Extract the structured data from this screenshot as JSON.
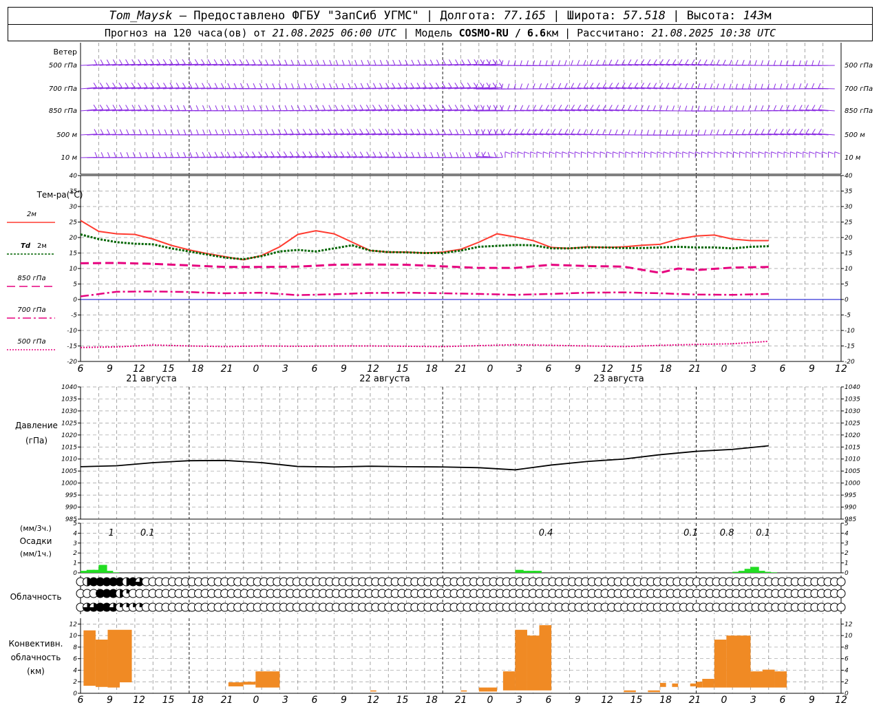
{
  "header": {
    "station": "Tom_Maysk",
    "provider": "– Предоставлено ФГБУ \"ЗапСиб УГМС\" |",
    "lon_label": "Долгота:",
    "lon": "77.165",
    "lat_label": "| Широта:",
    "lat": "57.518",
    "alt_label": "| Высота:",
    "alt": "143",
    "alt_unit": "м",
    "forecast_prefix": "Прогноз на 120 часа(ов) от",
    "issued": "21.08.2025 06:00 UTC",
    "model_label": "| Модель",
    "model": "COSMO-RU / 6.6",
    "model_unit": "км",
    "calc_label": "| Рассчитано:",
    "calculated": "21.08.2025 10:38 UTC"
  },
  "labels": {
    "wind_title": "Ветер",
    "wind_levels": [
      "500 гПа",
      "700 гПа",
      "850 гПа",
      "500 м",
      "10 м"
    ],
    "temp_title": "Тем-ра(°C)",
    "legend_2m": "2м",
    "legend_td": "Td",
    "legend_td_suffix": "2м",
    "legend_850": "850 гПа",
    "legend_700": "700 гПа",
    "legend_500": "500 гПа",
    "pressure_title": "Давление",
    "pressure_unit": "(гПа)",
    "precip_unit_3h": "(мм/3ч.)",
    "precip_title": "Осадки",
    "precip_unit_1h": "(мм/1ч.)",
    "cloud_title": "Облачность",
    "conv_title_1": "Конвективн.",
    "conv_title_2": "облачность",
    "conv_unit": "(км)"
  },
  "colors": {
    "wind": "#8a2be2",
    "t2m": "#ff3b30",
    "td2m": "#006400",
    "t850": "#e6007e",
    "t700": "#e6007e",
    "t500": "#e6007e",
    "zero_line": "#0000cc",
    "pressure": "#000000",
    "precip": "#22dd22",
    "convective": "#f08a24",
    "grid": "#999999"
  },
  "chart_data": [
    {
      "type": "line",
      "title": "Тем-ра(°C)",
      "x": [
        0,
        6,
        12,
        18,
        24,
        30,
        36,
        42,
        48,
        54,
        60,
        66,
        72,
        78,
        84,
        90,
        96,
        102,
        108,
        114,
        120,
        126
      ],
      "x_tick_labels": [
        "6",
        "9",
        "12",
        "15",
        "18",
        "21",
        "0",
        "3",
        "6",
        "9",
        "12",
        "15",
        "18",
        "21",
        "0",
        "3",
        "6",
        "9",
        "12",
        "15",
        "18",
        "21",
        "0",
        "3",
        "6",
        "9",
        "12"
      ],
      "day_labels": [
        "21 августа",
        "22 августа",
        "23 августа"
      ],
      "ylim": [
        -20,
        40
      ],
      "yticks": [
        -20,
        -15,
        -10,
        -5,
        0,
        5,
        10,
        15,
        20,
        25,
        30,
        35,
        40
      ],
      "series": [
        {
          "name": "2м",
          "style": "solid",
          "x": [
            0,
            3,
            6,
            9,
            12,
            15,
            18,
            21,
            24,
            27,
            30,
            33,
            36,
            39,
            42,
            45,
            48,
            51,
            54,
            57,
            60,
            63,
            66,
            69,
            72,
            75,
            78,
            81,
            84,
            87,
            90,
            93,
            96,
            99,
            102,
            105,
            108,
            111,
            114
          ],
          "values": [
            25.5,
            22,
            21.2,
            21,
            19.5,
            17.5,
            16,
            14.8,
            13.8,
            12.8,
            14.2,
            17,
            21,
            22.2,
            21.2,
            18.5,
            15.8,
            15.3,
            15.3,
            15,
            15.3,
            16.2,
            18.5,
            21.2,
            20.2,
            19,
            16.8,
            16.5,
            17,
            16.8,
            17,
            17.5,
            17.8,
            19.5,
            20.5,
            20.8,
            19.5,
            19,
            19
          ]
        },
        {
          "name": "Td 2м",
          "style": "dotted",
          "x": [
            0,
            3,
            6,
            9,
            12,
            15,
            18,
            21,
            24,
            27,
            30,
            33,
            36,
            39,
            42,
            45,
            48,
            51,
            54,
            57,
            60,
            63,
            66,
            69,
            72,
            75,
            78,
            81,
            84,
            87,
            90,
            93,
            96,
            99,
            102,
            105,
            108,
            111,
            114
          ],
          "values": [
            21,
            19.5,
            18.5,
            18,
            17.8,
            16.5,
            15.5,
            14.5,
            13.5,
            13,
            14,
            15.5,
            16,
            15.5,
            16.5,
            17.5,
            15.8,
            15.3,
            15.2,
            15,
            15,
            15.8,
            17,
            17.3,
            17.6,
            17.5,
            16.5,
            16.5,
            16.8,
            16.8,
            16.6,
            16.6,
            16.8,
            17,
            16.8,
            16.8,
            16.5,
            17,
            17.2
          ]
        },
        {
          "name": "850 гПа",
          "style": "dashed",
          "x": [
            0,
            6,
            12,
            18,
            24,
            30,
            36,
            42,
            48,
            54,
            60,
            66,
            72,
            78,
            84,
            90,
            96,
            99,
            102,
            108,
            114
          ],
          "values": [
            11.7,
            11.8,
            11.5,
            11,
            10.5,
            10.5,
            10.6,
            11.2,
            11.3,
            11.2,
            10.7,
            10.2,
            10.2,
            11.2,
            10.8,
            10.6,
            8.6,
            10,
            9.5,
            10.3,
            10.5
          ]
        },
        {
          "name": "700 гПа",
          "style": "dashdot",
          "x": [
            0,
            6,
            12,
            18,
            24,
            30,
            36,
            42,
            48,
            54,
            60,
            66,
            72,
            78,
            84,
            90,
            96,
            102,
            108,
            114
          ],
          "values": [
            1,
            2.5,
            2.6,
            2.4,
            2,
            2.2,
            1.4,
            1.7,
            2.1,
            2.2,
            2,
            1.8,
            1.5,
            1.8,
            2.2,
            2.3,
            2,
            1.6,
            1.5,
            1.8
          ]
        },
        {
          "name": "500 гПа",
          "style": "dotted",
          "x": [
            0,
            6,
            12,
            18,
            24,
            30,
            36,
            42,
            48,
            54,
            60,
            66,
            72,
            78,
            84,
            90,
            96,
            102,
            108,
            114
          ],
          "values": [
            -15.5,
            -15.3,
            -14.7,
            -15,
            -15.2,
            -15,
            -15.1,
            -15,
            -15,
            -15.1,
            -15.2,
            -14.9,
            -14.6,
            -14.8,
            -15,
            -15.2,
            -14.8,
            -14.5,
            -14.3,
            -13.5
          ]
        }
      ]
    },
    {
      "type": "line",
      "title": "Давление",
      "ylabel": "(гПа)",
      "ylim": [
        985,
        1040
      ],
      "yticks": [
        985,
        990,
        995,
        1000,
        1005,
        1010,
        1015,
        1020,
        1025,
        1030,
        1035,
        1040
      ],
      "x": [
        0,
        6,
        12,
        18,
        24,
        30,
        36,
        42,
        48,
        54,
        60,
        66,
        72,
        78,
        84,
        90,
        96,
        102,
        108,
        114
      ],
      "values": [
        1006.8,
        1007.2,
        1008.5,
        1009.3,
        1009.4,
        1008.5,
        1006.9,
        1006.7,
        1007.0,
        1006.8,
        1006.7,
        1006.4,
        1005.5,
        1007.5,
        1009.0,
        1010.0,
        1011.8,
        1013.2,
        1014.0,
        1015.5
      ]
    },
    {
      "type": "bar",
      "title": "Осадки",
      "ylim": [
        0,
        5
      ],
      "yticks": [
        0,
        1,
        2,
        3,
        4,
        5
      ],
      "x": [
        0,
        1,
        2,
        3,
        4,
        5,
        6,
        72,
        73,
        74,
        75,
        76,
        108,
        109,
        110,
        111,
        112,
        113,
        114
      ],
      "values": [
        0.2,
        0.3,
        0.3,
        0.8,
        0.2,
        0.05,
        0,
        0.3,
        0.2,
        0.2,
        0.2,
        0,
        0.1,
        0.2,
        0.4,
        0.6,
        0.2,
        0.1,
        0.05
      ],
      "annotations": [
        {
          "x": 6,
          "text": "1"
        },
        {
          "x": 12,
          "text": "0.1"
        },
        {
          "x": 78,
          "text": "0.4"
        },
        {
          "x": 102,
          "text": "0.1"
        },
        {
          "x": 108,
          "text": "0.8"
        },
        {
          "x": 114,
          "text": "0.1"
        }
      ]
    },
    {
      "type": "table",
      "title": "Облачность",
      "rows": [
        [
          0,
          2,
          4,
          4,
          4,
          4,
          4,
          2,
          4,
          3,
          0,
          0,
          0,
          0,
          0,
          0,
          0,
          0,
          0,
          0,
          0,
          0,
          0,
          0,
          0,
          0,
          0,
          0,
          0,
          0,
          0,
          0,
          0,
          0,
          0,
          0,
          0,
          0,
          0,
          0,
          0,
          0,
          0,
          0,
          0,
          0,
          0,
          0,
          0,
          0,
          0,
          0,
          0,
          0,
          0,
          0,
          0,
          0,
          0,
          0,
          0,
          0,
          0,
          0,
          0,
          0,
          0,
          0,
          0,
          0,
          0,
          0,
          0,
          0,
          0,
          0,
          0,
          0,
          0,
          0,
          0,
          0,
          0,
          0,
          0,
          0,
          0,
          0,
          0,
          0,
          0,
          0,
          0,
          0,
          0,
          0,
          0,
          0,
          0,
          0,
          0,
          0,
          0,
          0,
          0,
          0,
          0,
          0,
          0,
          0,
          0,
          0,
          0,
          0,
          0,
          0,
          0
        ],
        [
          0,
          0,
          0,
          4,
          4,
          4,
          2,
          1,
          0,
          0,
          0,
          0,
          0,
          0,
          0,
          0,
          0,
          0,
          0,
          0,
          0,
          0,
          0,
          0,
          0,
          0,
          0,
          0,
          0,
          0,
          0,
          0,
          0,
          0,
          0,
          0,
          0,
          0,
          0,
          0,
          0,
          0,
          0,
          0,
          0,
          0,
          0,
          0,
          0,
          0,
          0,
          0,
          0,
          0,
          0,
          0,
          0,
          0,
          0,
          0,
          0,
          0,
          0,
          0,
          0,
          0,
          0,
          0,
          0,
          0,
          0,
          0,
          0,
          0,
          0,
          0,
          0,
          0,
          0,
          0,
          0,
          0,
          0,
          0,
          0,
          0,
          0,
          0,
          0,
          0,
          0,
          0,
          0,
          0,
          0,
          0,
          0,
          0,
          0,
          0,
          0,
          0,
          0,
          0,
          0,
          0,
          0,
          0,
          0,
          0,
          0,
          0,
          0,
          0,
          0,
          0,
          0
        ],
        [
          0,
          3,
          3,
          4,
          4,
          3,
          1,
          1,
          1,
          1,
          0,
          0,
          0,
          0,
          0,
          0,
          0,
          0,
          0,
          0,
          0,
          0,
          0,
          0,
          0,
          0,
          0,
          0,
          0,
          0,
          0,
          0,
          0,
          0,
          0,
          0,
          0,
          0,
          0,
          0,
          0,
          0,
          0,
          0,
          0,
          0,
          0,
          0,
          0,
          0,
          0,
          0,
          0,
          0,
          0,
          0,
          0,
          0,
          0,
          0,
          0,
          0,
          0,
          0,
          0,
          0,
          0,
          0,
          0,
          0,
          0,
          0,
          0,
          0,
          0,
          0,
          0,
          0,
          0,
          0,
          0,
          0,
          0,
          0,
          0,
          0,
          0,
          0,
          0,
          0,
          0,
          0,
          0,
          0,
          0,
          0,
          0,
          0,
          0,
          0,
          0,
          0,
          0,
          0,
          0,
          0,
          0,
          0,
          0,
          0,
          0,
          0,
          0,
          0,
          0,
          0,
          0
        ]
      ]
    },
    {
      "type": "bar",
      "title": "Конвективн. облачность",
      "ylabel": "(км)",
      "ylim": [
        0,
        13
      ],
      "yticks": [
        0,
        2,
        4,
        6,
        8,
        10,
        12
      ],
      "bars": [
        {
          "x0": 0.5,
          "x1": 2.5,
          "base": 1.3,
          "top": 10.9
        },
        {
          "x0": 2.5,
          "x1": 4.5,
          "base": 1.1,
          "top": 9.3
        },
        {
          "x0": 4.5,
          "x1": 6.5,
          "base": 1.0,
          "top": 11.0
        },
        {
          "x0": 6.5,
          "x1": 8.5,
          "base": 1.9,
          "top": 11.0
        },
        {
          "x0": 24.5,
          "x1": 27,
          "base": 1.2,
          "top": 1.9
        },
        {
          "x0": 27,
          "x1": 29,
          "base": 1.5,
          "top": 2.0
        },
        {
          "x0": 29,
          "x1": 33,
          "base": 1.0,
          "top": 3.8
        },
        {
          "x0": 48,
          "x1": 49,
          "base": 0.3,
          "top": 0.5
        },
        {
          "x0": 63,
          "x1": 64,
          "base": 0.3,
          "top": 0.5
        },
        {
          "x0": 66,
          "x1": 67.5,
          "base": 0.3,
          "top": 1.0
        },
        {
          "x0": 67.5,
          "x1": 69,
          "base": 0.3,
          "top": 1.0
        },
        {
          "x0": 70,
          "x1": 72,
          "base": 0.5,
          "top": 3.8
        },
        {
          "x0": 72,
          "x1": 74,
          "base": 0.5,
          "top": 11.0
        },
        {
          "x0": 74,
          "x1": 76,
          "base": 0.5,
          "top": 10.0
        },
        {
          "x0": 76,
          "x1": 78,
          "base": 0.5,
          "top": 11.8
        },
        {
          "x0": 90,
          "x1": 91,
          "base": 0.2,
          "top": 0.5
        },
        {
          "x0": 91,
          "x1": 92,
          "base": 0.2,
          "top": 0.5
        },
        {
          "x0": 94,
          "x1": 96,
          "base": 0.2,
          "top": 0.5
        },
        {
          "x0": 96,
          "x1": 97,
          "base": 1.1,
          "top": 1.8
        },
        {
          "x0": 98,
          "x1": 99,
          "base": 1.1,
          "top": 1.7
        },
        {
          "x0": 101,
          "x1": 102,
          "base": 1.2,
          "top": 1.7
        },
        {
          "x0": 102,
          "x1": 103,
          "base": 1.0,
          "top": 2.0
        },
        {
          "x0": 103,
          "x1": 105,
          "base": 1.0,
          "top": 2.5
        },
        {
          "x0": 105,
          "x1": 107,
          "base": 1.0,
          "top": 9.3
        },
        {
          "x0": 107,
          "x1": 111,
          "base": 1.0,
          "top": 10.0
        },
        {
          "x0": 111,
          "x1": 113,
          "base": 1.0,
          "top": 3.8
        },
        {
          "x0": 113,
          "x1": 115,
          "base": 1.0,
          "top": 4.1
        },
        {
          "x0": 115,
          "x1": 117,
          "base": 1.0,
          "top": 3.8
        }
      ]
    }
  ]
}
